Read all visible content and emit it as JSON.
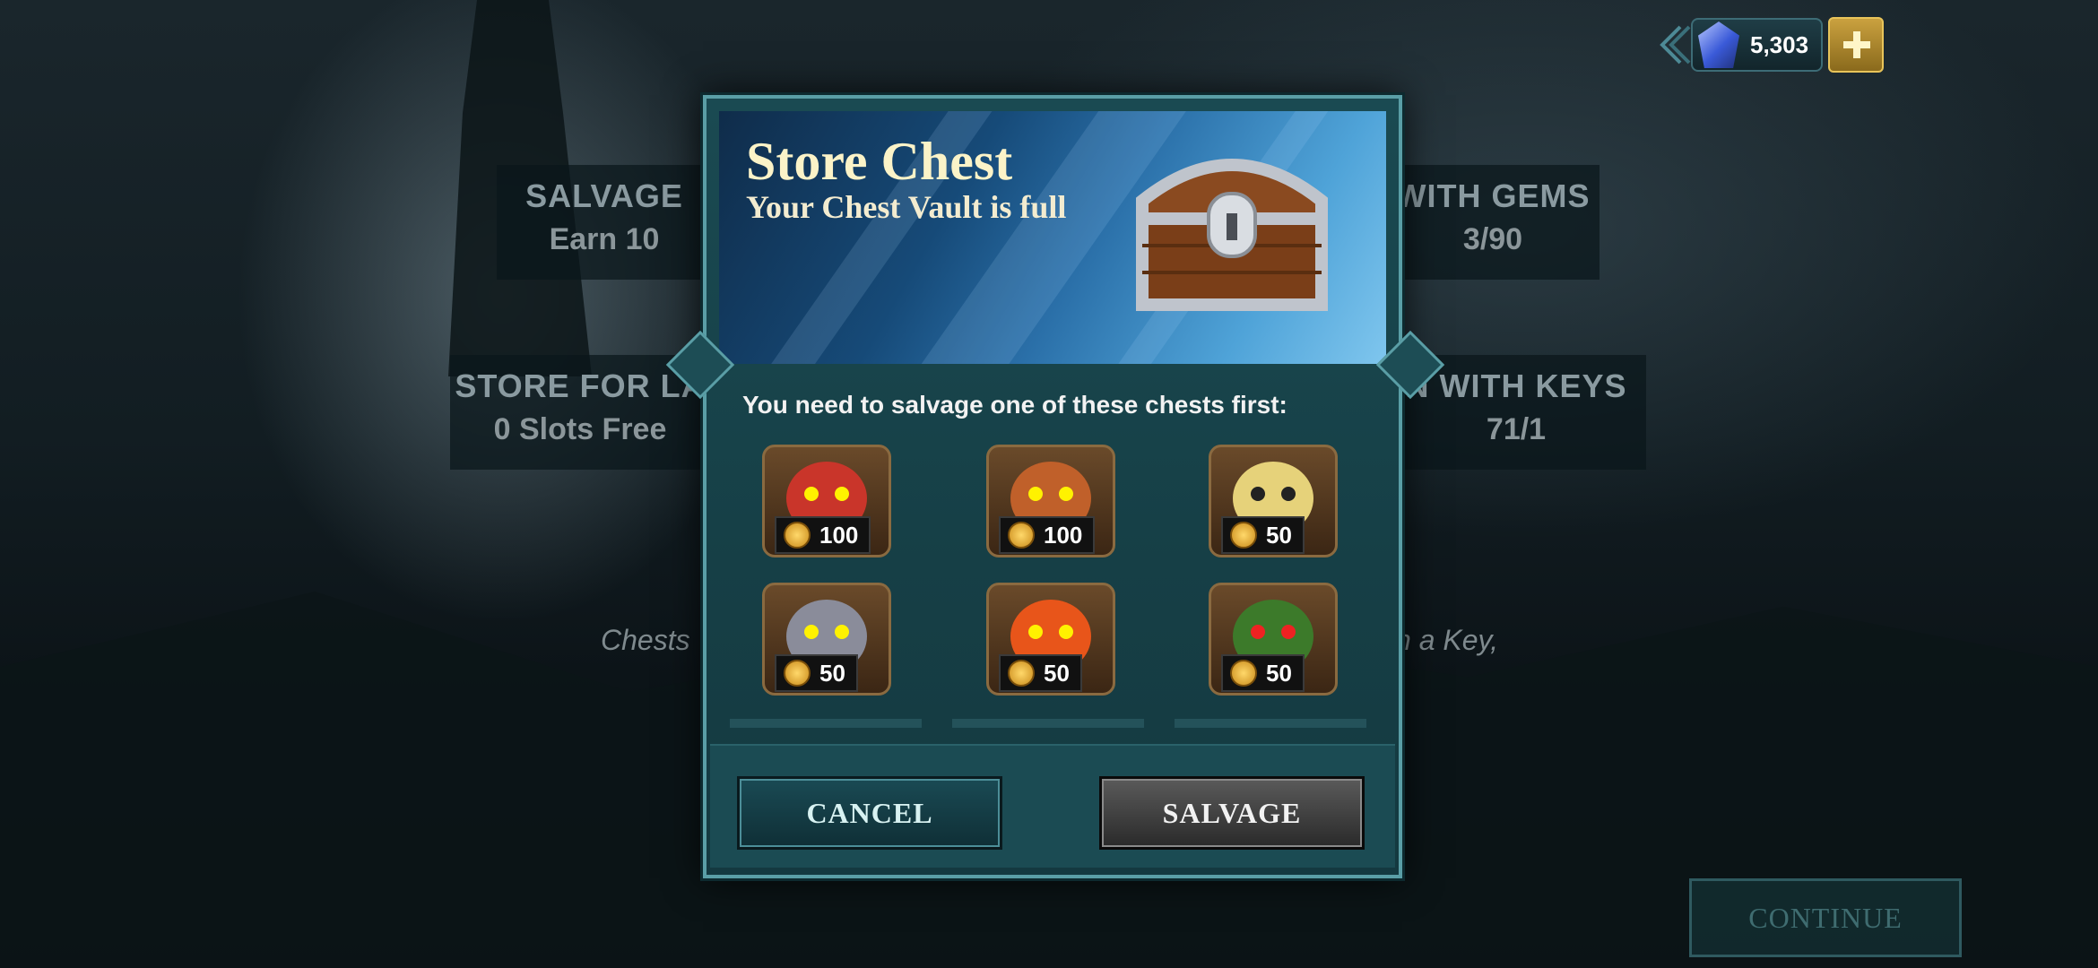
{
  "background": {
    "panels": [
      {
        "title": "SALVAGE",
        "sub": "Earn 10"
      },
      {
        "title": "WITH GEMS",
        "sub": "3/90"
      },
      {
        "title": "STORE FOR LA",
        "sub": "0 Slots Free"
      },
      {
        "title": "N WITH KEYS",
        "sub": "71/1"
      }
    ],
    "hint_left": "Chests",
    "hint_right": "n a Key,",
    "continue_label": "CONTINUE"
  },
  "currency": {
    "gems": "5,303",
    "icon": "gem-icon",
    "add_icon": "plus-icon"
  },
  "modal": {
    "title": "Store Chest",
    "subtitle": "Your Chest Vault is full",
    "prompt": "You need to salvage one of these chests first:",
    "chests": [
      {
        "name": "red-imp-chest",
        "cost": "100",
        "color": "#c9352a"
      },
      {
        "name": "horned-viking-chest",
        "cost": "100",
        "color": "#c0602a"
      },
      {
        "name": "golden-ghost-chest",
        "cost": "50",
        "color": "#e6d27a"
      },
      {
        "name": "grey-wolf-chest",
        "cost": "50",
        "color": "#8a8c9a"
      },
      {
        "name": "fire-spirit-chest",
        "cost": "50",
        "color": "#e8551a"
      },
      {
        "name": "green-spider-chest",
        "cost": "50",
        "color": "#3c7a2a"
      }
    ],
    "cancel_label": "CANCEL",
    "salvage_label": "SALVAGE"
  }
}
